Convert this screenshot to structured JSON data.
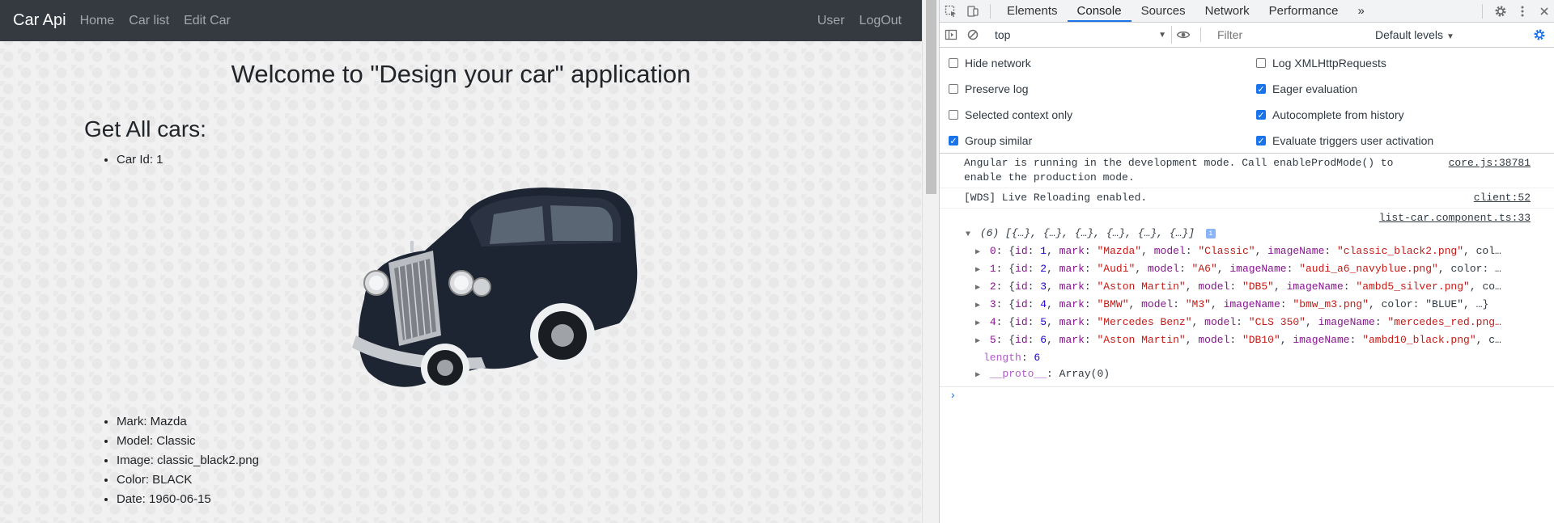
{
  "navbar": {
    "brand": "Car Api",
    "links": [
      "Home",
      "Car list",
      "Edit Car"
    ],
    "right_links": [
      "User",
      "LogOut"
    ]
  },
  "page": {
    "title": "Welcome to \"Design your car\" application",
    "section_title": "Get All cars:",
    "car_id": "Car Id: 1",
    "details": [
      "Mark: Mazda",
      "Model: Classic",
      "Image: classic_black2.png",
      "Color: BLACK",
      "Date: 1960-06-15"
    ]
  },
  "devtools": {
    "tabs": [
      "Elements",
      "Console",
      "Sources",
      "Network",
      "Performance"
    ],
    "active_tab": "Console",
    "more_tabs_glyph": "»",
    "context": "top",
    "filter_placeholder": "Filter",
    "levels": "Default levels",
    "settings": {
      "left": [
        {
          "label": "Hide network",
          "checked": false
        },
        {
          "label": "Preserve log",
          "checked": false
        },
        {
          "label": "Selected context only",
          "checked": false
        },
        {
          "label": "Group similar",
          "checked": true
        }
      ],
      "right": [
        {
          "label": "Log XMLHttpRequests",
          "checked": false
        },
        {
          "label": "Eager evaluation",
          "checked": true
        },
        {
          "label": "Autocomplete from history",
          "checked": true
        },
        {
          "label": "Evaluate triggers user activation",
          "checked": true
        }
      ]
    },
    "messages": [
      {
        "text_line1": "Angular is running in the development mode. Call enableProdMode() to",
        "text_line2": "enable the production mode.",
        "source": "core.js:38781"
      },
      {
        "text": "[WDS] Live Reloading enabled.",
        "source": "client:52"
      }
    ],
    "object_log": {
      "source": "list-car.component.ts:33",
      "summary": "(6) [{…}, {…}, {…}, {…}, {…}, {…}]",
      "rows": [
        {
          "idx": "0",
          "id": "1",
          "mark": "\"Mazda\"",
          "model": "\"Classic\"",
          "image": "\"classic_black2.png\"",
          "rest": ", col…"
        },
        {
          "idx": "1",
          "id": "2",
          "mark": "\"Audi\"",
          "model": "\"A6\"",
          "image": "\"audi_a6_navyblue.png\"",
          "rest": ", color: …"
        },
        {
          "idx": "2",
          "id": "3",
          "mark": "\"Aston Martin\"",
          "model": "\"DB5\"",
          "image": "\"ambd5_silver.png\"",
          "rest": ", co…"
        },
        {
          "idx": "3",
          "id": "4",
          "mark": "\"BMW\"",
          "model": "\"M3\"",
          "image": "\"bmw_m3.png\"",
          "rest": ", color: \"BLUE\", …}"
        },
        {
          "idx": "4",
          "id": "5",
          "mark": "\"Mercedes Benz\"",
          "model": "\"CLS 350\"",
          "image": "\"mercedes_red.png…",
          "rest": ""
        },
        {
          "idx": "5",
          "id": "6",
          "mark": "\"Aston Martin\"",
          "model": "\"DB10\"",
          "image": "\"ambd10_black.png\"",
          "rest": ", c…"
        }
      ],
      "length_label": "length",
      "length_value": "6",
      "proto_label": "__proto__",
      "proto_value": "Array(0)"
    },
    "prompt": "›"
  }
}
